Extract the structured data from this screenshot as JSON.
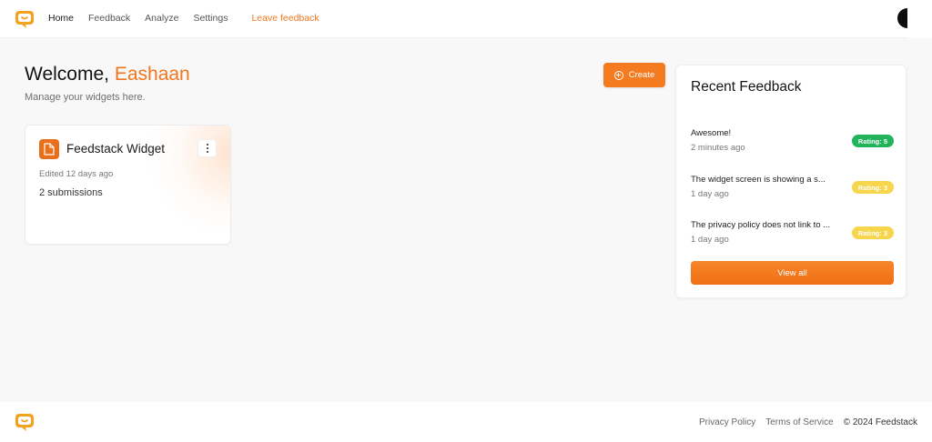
{
  "brand": {
    "logo_icon": "chat-bubble-logo-icon",
    "accent": "#f0761f"
  },
  "nav": {
    "items": [
      {
        "label": "Home"
      },
      {
        "label": "Feedback"
      },
      {
        "label": "Analyze"
      },
      {
        "label": "Settings"
      }
    ],
    "leave_feedback": "Leave feedback"
  },
  "welcome": {
    "prefix": "Welcome,",
    "name": "Eashaan",
    "subtitle": "Manage your widgets here."
  },
  "create_button": {
    "label": "Create",
    "icon": "plus-circle-icon"
  },
  "widget": {
    "icon": "file-icon",
    "title": "Feedstack Widget",
    "edited": "Edited 12 days ago",
    "submissions": "2 submissions"
  },
  "recent_feedback": {
    "title": "Recent Feedback",
    "items": [
      {
        "text": "Awesome!",
        "time": "2 minutes ago",
        "rating_label": "Rating: 5",
        "rating": 5,
        "color": "#22b45a"
      },
      {
        "text": "The widget screen is showing a s...",
        "time": "1 day ago",
        "rating_label": "Rating: 3",
        "rating": 3,
        "color": "#f7d54c"
      },
      {
        "text": "The privacy policy does not link to ...",
        "time": "1 day ago",
        "rating_label": "Rating: 3",
        "rating": 3,
        "color": "#f7d54c"
      }
    ],
    "view_all": "View all"
  },
  "footer": {
    "privacy": "Privacy Policy",
    "terms": "Terms of Service",
    "copyright": "© 2024 Feedstack"
  }
}
